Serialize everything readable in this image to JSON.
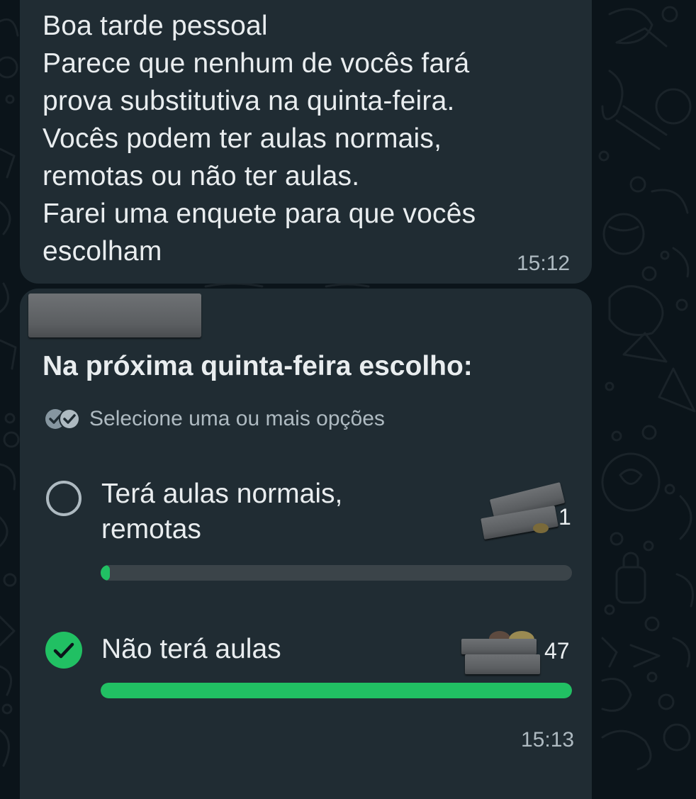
{
  "chat": {
    "message_1": {
      "lines": [
        "Boa tarde pessoal",
        "Parece que nenhum de vocês fará",
        "prova substitutiva na quinta-feira.",
        "Vocês podem ter aulas normais,",
        "remotas ou não ter aulas.",
        "Farei uma enquete para que vocês",
        "escolham"
      ],
      "time": "15:12"
    },
    "poll": {
      "question": "Na próxima quinta-feira escolho:",
      "subtitle": "Selecione uma ou mais opções",
      "subtitle_icon": "double-check-icon",
      "options": [
        {
          "label_lines": [
            "Terá aulas normais,",
            "remotas"
          ],
          "votes": "1",
          "fraction": 0.015,
          "selected": false
        },
        {
          "label_lines": [
            "Não terá aulas"
          ],
          "votes": "47",
          "fraction": 1.0,
          "selected": true
        }
      ],
      "time": "15:13"
    }
  },
  "colors": {
    "background": "#0b141a",
    "bubble": "#202c33",
    "accent_green": "#21c063",
    "bar_track": "#3b4449",
    "muted_text": "#aebac1",
    "text": "#e9edef"
  }
}
